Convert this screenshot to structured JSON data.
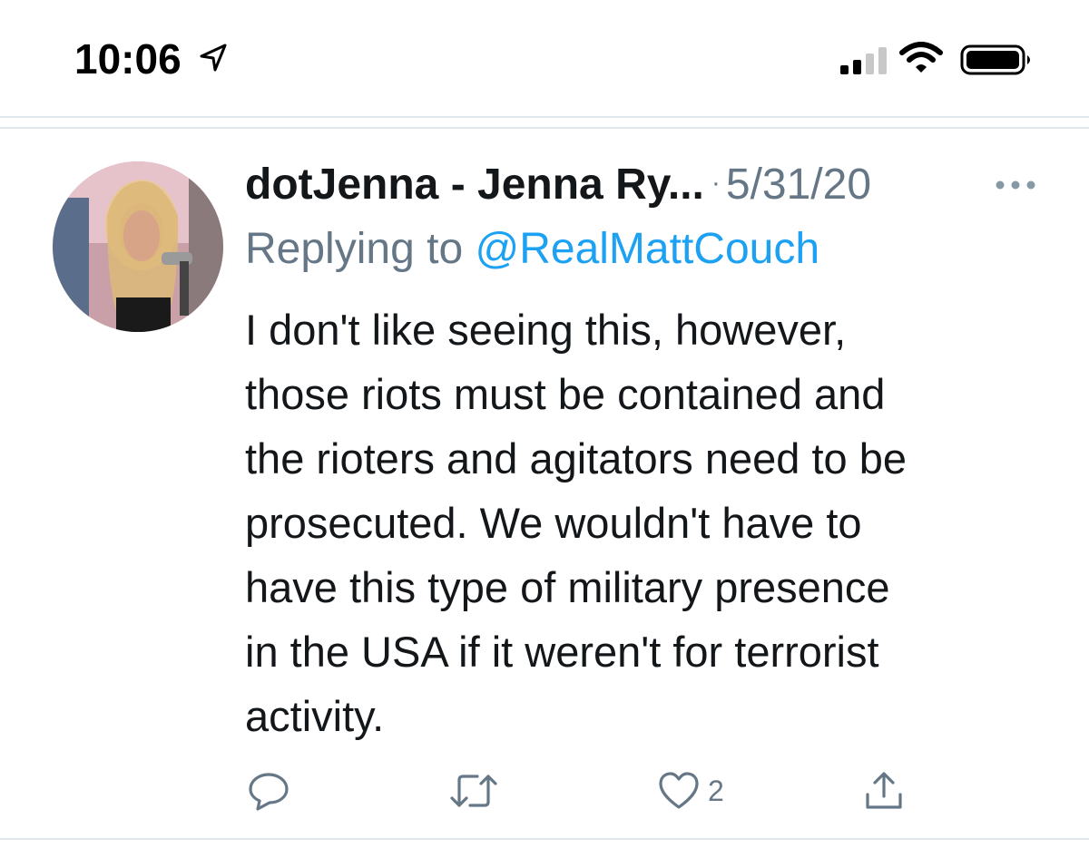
{
  "status_bar": {
    "time": "10:06",
    "location_icon": "location-arrow-icon",
    "signal_icon": "cellular-signal-icon",
    "wifi_icon": "wifi-icon",
    "battery_icon": "battery-icon"
  },
  "tweet": {
    "display_name": "dotJenna - Jenna Ry...",
    "separator": "·",
    "date": "5/31/20",
    "more_icon": "more-options-icon",
    "replying_prefix": "Replying to",
    "replying_handle": "@RealMattCouch",
    "text_lines": [
      "I don't like seeing this, however,",
      "those riots must be contained and",
      "the rioters and agitators need to be",
      "prosecuted. We wouldn't have to",
      "have this type of military presence",
      "in the USA if it weren't for terrorist",
      "activity."
    ],
    "actions": {
      "reply_icon": "reply-icon",
      "retweet_icon": "retweet-icon",
      "like_icon": "heart-icon",
      "like_count": "2",
      "share_icon": "share-icon"
    }
  },
  "colors": {
    "text": "#14171a",
    "secondary": "#657786",
    "link": "#1da1f2",
    "divider": "#e1e8ed"
  }
}
